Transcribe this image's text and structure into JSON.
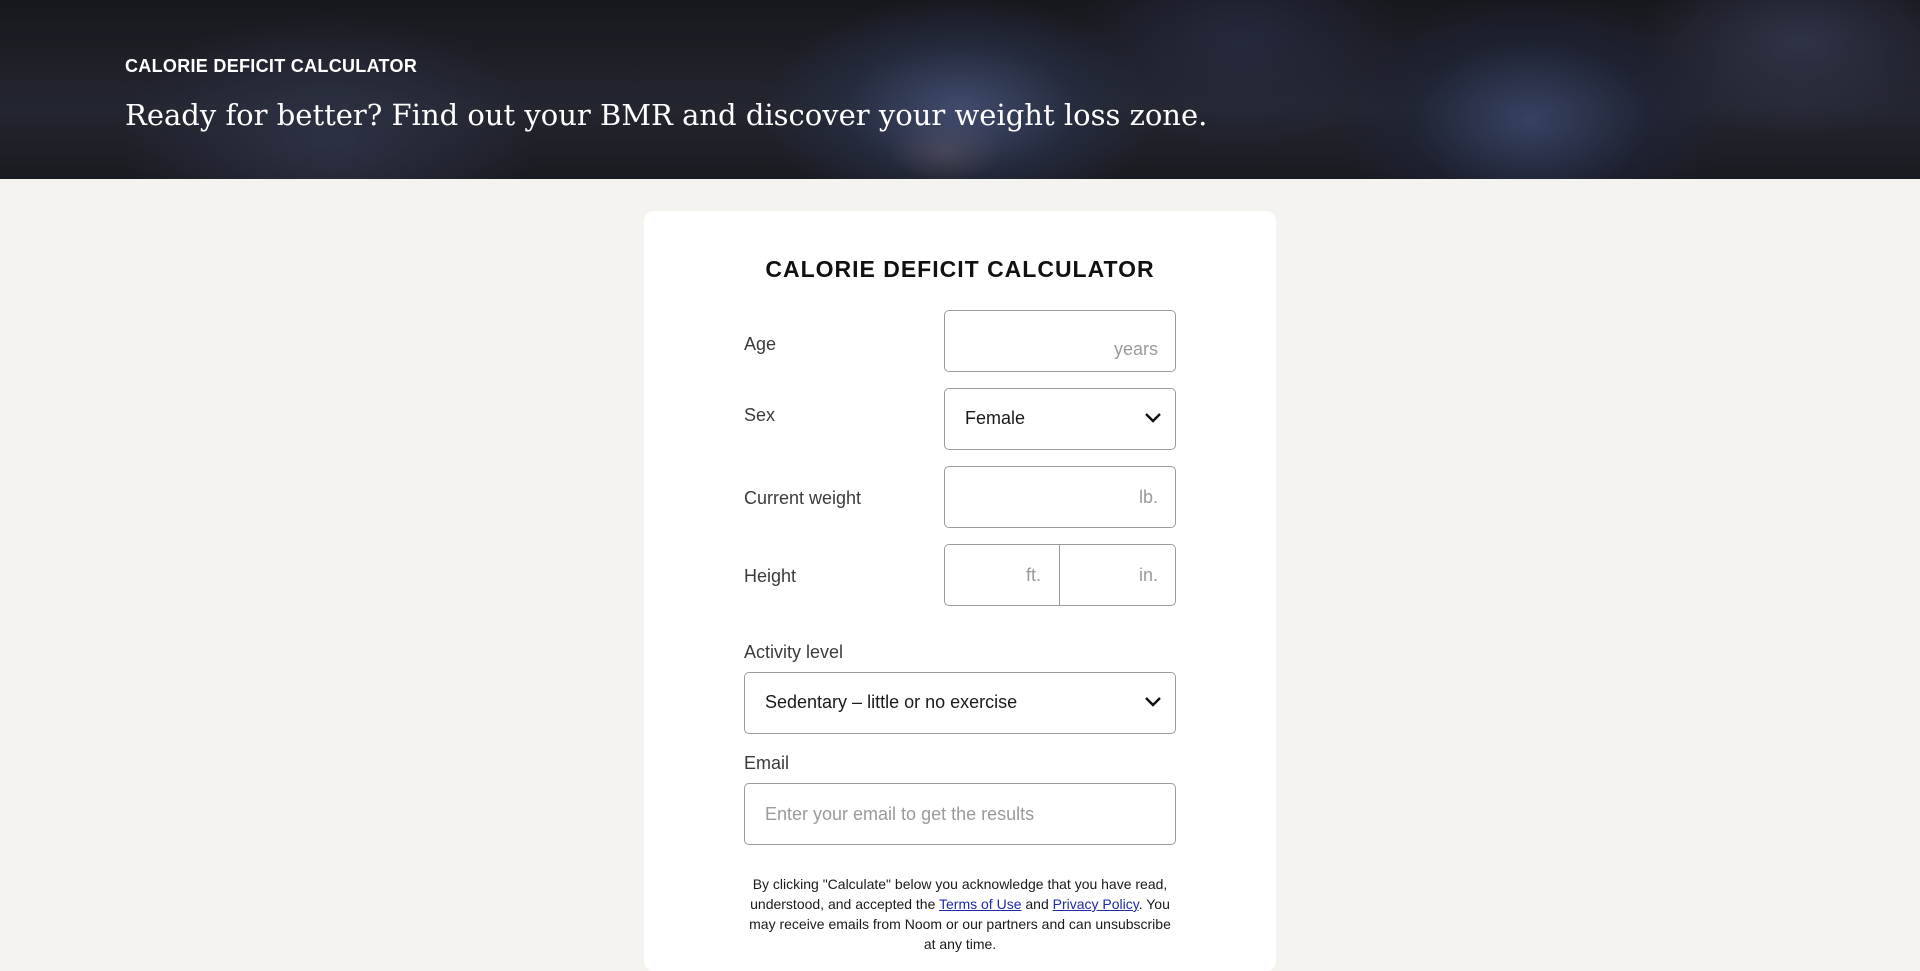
{
  "hero": {
    "kicker": "CALORIE DEFICIT CALCULATOR",
    "title": "Ready for better? Find out your BMR and discover your weight loss zone."
  },
  "form": {
    "title": "CALORIE DEFICIT CALCULATOR",
    "age": {
      "label": "Age",
      "unit": "years",
      "value": ""
    },
    "sex": {
      "label": "Sex",
      "selected": "Female"
    },
    "weight": {
      "label": "Current weight",
      "unit": "lb.",
      "value": ""
    },
    "height": {
      "label": "Height",
      "feet_unit": "ft.",
      "inches_unit": "in.",
      "feet_value": "",
      "inches_value": ""
    },
    "activity": {
      "label": "Activity level",
      "selected": "Sedentary – little or no exercise"
    },
    "email": {
      "label": "Email",
      "placeholder": "Enter your email to get the results",
      "value": ""
    }
  },
  "legal": {
    "text_1": "By clicking \"Calculate\" below you acknowledge that you have read, understood, and accepted the ",
    "terms_link": "Terms of Use",
    "text_2": " and ",
    "privacy_link": "Privacy Policy",
    "text_3": ". You may receive emails from Noom or our partners and can unsubscribe at any time."
  },
  "icons": {
    "select_arrow": "chevron-down-icon"
  },
  "colors": {
    "page_background": "#f4f3ef",
    "card_background": "#ffffff",
    "link": "#1f2aa8",
    "field_border": "#9a9a9a"
  }
}
